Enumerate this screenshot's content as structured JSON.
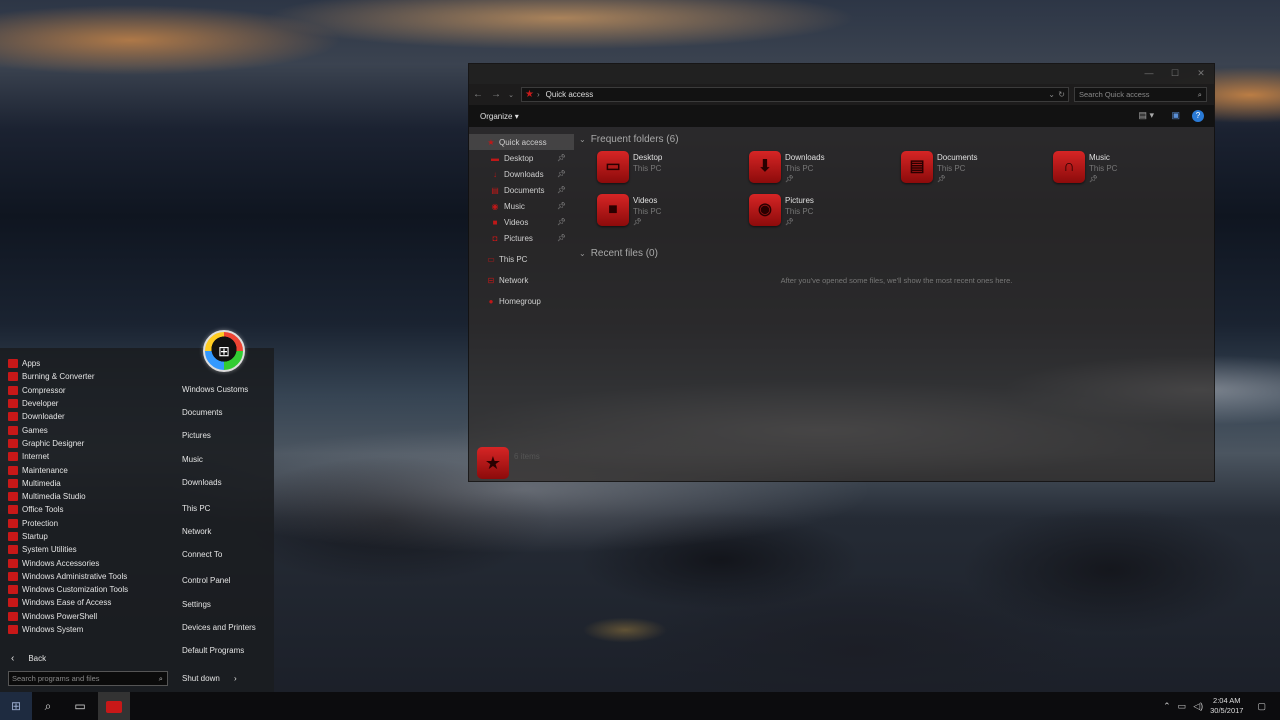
{
  "explorer": {
    "address_path": "Quick access",
    "search_placeholder": "Search Quick access",
    "organize_label": "Organize",
    "nav": [
      {
        "label": "Quick access",
        "icon": "star-icon",
        "selected": true,
        "pinned": false
      },
      {
        "label": "Desktop",
        "icon": "desktop-icon",
        "pinned": true
      },
      {
        "label": "Downloads",
        "icon": "download-icon",
        "pinned": true
      },
      {
        "label": "Documents",
        "icon": "document-icon",
        "pinned": true
      },
      {
        "label": "Music",
        "icon": "music-icon",
        "pinned": true
      },
      {
        "label": "Videos",
        "icon": "video-icon",
        "pinned": true
      },
      {
        "label": "Pictures",
        "icon": "camera-icon",
        "pinned": true
      },
      {
        "label": "This PC",
        "icon": "computer-icon"
      },
      {
        "label": "Network",
        "icon": "network-icon"
      },
      {
        "label": "Homegroup",
        "icon": "homegroup-icon"
      }
    ],
    "frequent_header": "Frequent folders (6)",
    "folders": [
      {
        "name": "Desktop",
        "location": "This PC",
        "icon": "desktop-icon"
      },
      {
        "name": "Downloads",
        "location": "This PC",
        "icon": "download-icon"
      },
      {
        "name": "Documents",
        "location": "This PC",
        "icon": "document-icon"
      },
      {
        "name": "Music",
        "location": "This PC",
        "icon": "headphones-icon"
      },
      {
        "name": "Videos",
        "location": "This PC",
        "icon": "video-icon"
      },
      {
        "name": "Pictures",
        "location": "This PC",
        "icon": "camera-icon"
      }
    ],
    "recent_header": "Recent files (0)",
    "recent_empty": "After you've opened some files, we'll show the most recent ones here.",
    "status_text": "6 items"
  },
  "start_menu": {
    "programs": [
      "Apps",
      "Burning & Converter",
      "Compressor",
      "Developer",
      "Downloader",
      "Games",
      "Graphic Designer",
      "Internet",
      "Maintenance",
      "Multimedia",
      "Multimedia Studio",
      "Office Tools",
      "Protection",
      "Startup",
      "System Utilities",
      "Windows Accessories",
      "Windows Administrative Tools",
      "Windows Customization Tools",
      "Windows Ease of Access",
      "Windows PowerShell",
      "Windows System"
    ],
    "links": [
      "Windows Customs",
      "Documents",
      "Pictures",
      "Music",
      "Downloads",
      "This PC",
      "Network",
      "Connect To",
      "Control Panel",
      "Settings",
      "Devices and Printers",
      "Default Programs"
    ],
    "back_label": "Back",
    "search_placeholder": "Search programs and files",
    "shutdown_label": "Shut down"
  },
  "taskbar": {
    "time": "2:04 AM",
    "date": "30/5/2017"
  },
  "colors": {
    "accent": "#c81818",
    "help": "#2a7ad6"
  }
}
